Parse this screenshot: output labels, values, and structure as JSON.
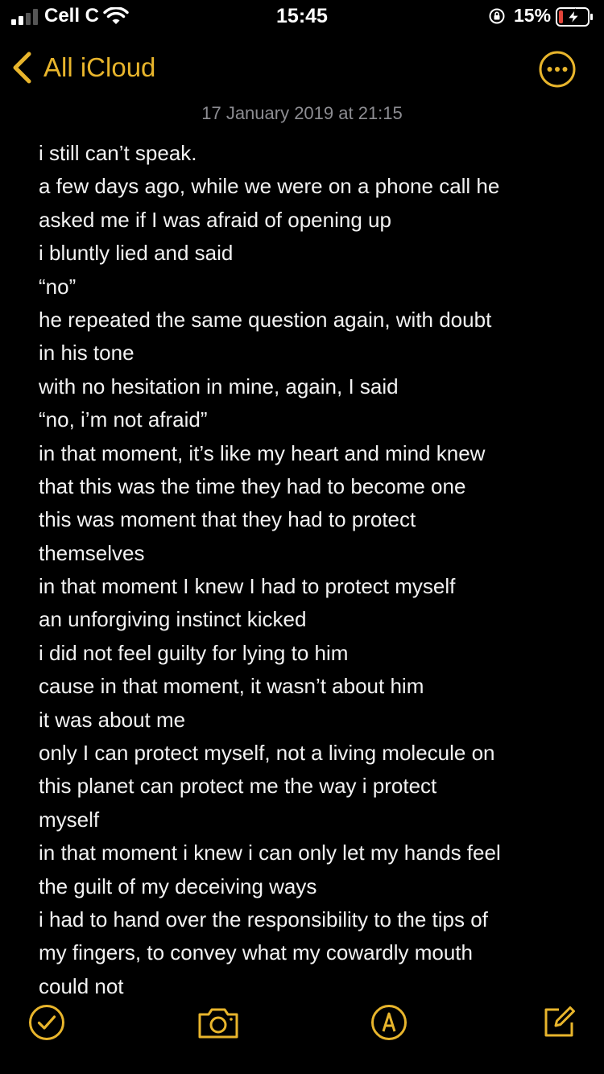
{
  "status_bar": {
    "carrier": "Cell C",
    "time": "15:45",
    "battery_percent": "15%"
  },
  "nav": {
    "back_label": "All iCloud",
    "icons": [
      "chevron-left-icon",
      "more-icon"
    ]
  },
  "note": {
    "date": "17 January 2019 at 21:15",
    "lines": [
      "i still can’t speak.",
      "a few days ago, while we were on a phone call he",
      "asked me if I was afraid of opening up",
      "i bluntly lied and said",
      "“no”",
      "he repeated the same question again, with doubt",
      "in his tone",
      "with no hesitation in mine, again, I said",
      "“no, i’m not afraid”",
      "in that moment, it’s like my heart and mind knew",
      "that this was the time they had to become one",
      "this was moment that they had to protect",
      "themselves",
      "in that moment I knew I had to protect myself",
      "an unforgiving instinct kicked",
      "i did not feel guilty for lying to him",
      "cause in that moment, it wasn’t about him",
      "it was about me",
      "only I can protect myself, not a living molecule on",
      "this planet can protect me the  way i protect",
      "myself",
      "in that moment i knew i can only let my hands feel",
      "the guilt of my deceiving ways",
      "i had to hand over the responsibility to the tips of",
      "my fingers, to convey what my cowardly mouth",
      "could not"
    ]
  },
  "toolbar": {
    "icons": [
      "checklist-icon",
      "camera-icon",
      "markup-icon",
      "compose-icon"
    ]
  },
  "colors": {
    "accent": "#e8b52c",
    "background": "#000000",
    "text": "#f2f2f2",
    "date": "#8d8d92",
    "battery_low": "#e5453a"
  }
}
